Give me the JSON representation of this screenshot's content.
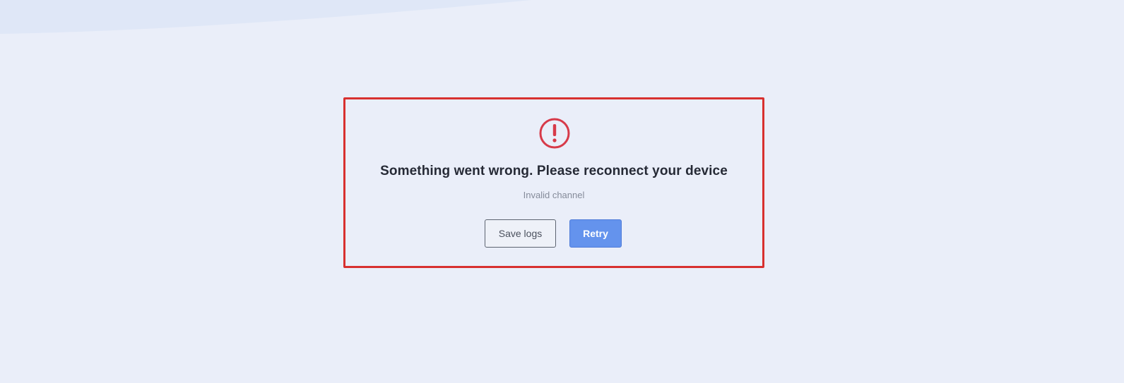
{
  "error": {
    "icon": "alert-circle-icon",
    "title": "Something went wrong. Please reconnect your device",
    "message": "Invalid channel"
  },
  "actions": {
    "save_logs_label": "Save logs",
    "retry_label": "Retry"
  },
  "colors": {
    "background": "#eaeef9",
    "wave": "#dfe7f7",
    "panel_border": "#d8302f",
    "alert_icon": "#d73a49",
    "primary_button": "#6493ed",
    "title_text": "#262a36",
    "subtitle_text": "#858b9a"
  }
}
